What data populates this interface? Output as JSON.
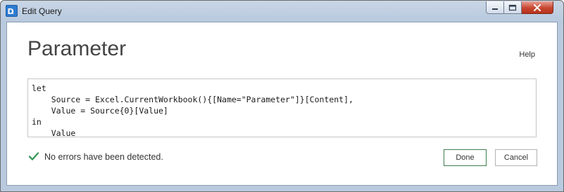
{
  "window": {
    "title": "Edit Query",
    "controls": [
      "minimize-icon",
      "maximize-icon",
      "close-icon"
    ]
  },
  "query": {
    "name": "Parameter",
    "help_label": "Help",
    "code_lines": [
      "let",
      "    Source = Excel.CurrentWorkbook(){[Name=\"Parameter\"]}[Content],",
      "    Value = Source{0}[Value]",
      "in",
      "    Value"
    ]
  },
  "status": {
    "icon": "checkmark-icon",
    "message": "No errors have been detected.",
    "color": "#3a9a5b"
  },
  "buttons": {
    "done_label": "Done",
    "cancel_label": "Cancel"
  }
}
